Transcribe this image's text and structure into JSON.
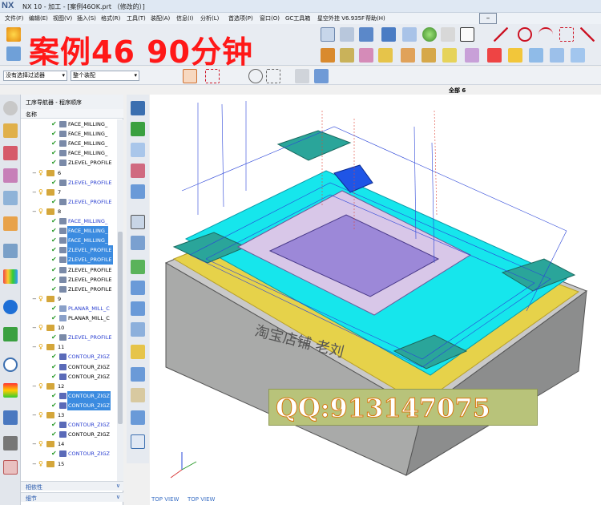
{
  "window": {
    "logo": "NX",
    "title": "NX 10 - 加工 - [案例46OK.prt （修改的）]"
  },
  "menu": [
    "文件(F)",
    "编辑(E)",
    "视图(V)",
    "插入(S)",
    "格式(R)",
    "工具(T)",
    "装配(A)",
    "信息(I)",
    "分析(L)",
    "首选项(P)",
    "窗口(O)",
    "GC工具箱",
    "星空外挂 V6.935F",
    "帮助(H)"
  ],
  "overlay": {
    "title": "案例46   90分钟",
    "qq": "QQ:913147075"
  },
  "selection": {
    "filter": "没有选择过滤器",
    "scope": "整个装配"
  },
  "viewport": {
    "layer_label": "全部 6",
    "view_labels": [
      "TOP VIEW",
      "TOP VIEW"
    ]
  },
  "navigator": {
    "title": "工序导航器 - 程序顺序",
    "column": "名称",
    "rows": [
      {
        "text": "FACE_MILLING_",
        "type": "op"
      },
      {
        "text": "FACE_MILLING_",
        "type": "op"
      },
      {
        "text": "FACE_MILLING_",
        "type": "op"
      },
      {
        "text": "FACE_MILLING_",
        "type": "op"
      },
      {
        "text": "ZLEVEL_PROFILE",
        "type": "op"
      },
      {
        "text": "6",
        "type": "group"
      },
      {
        "text": "ZLEVEL_PROFILE",
        "type": "op-blue"
      },
      {
        "text": "7",
        "type": "group"
      },
      {
        "text": "ZLEVEL_PROFILE",
        "type": "op-blue"
      },
      {
        "text": "8",
        "type": "group"
      },
      {
        "text": "FACE_MILLING_",
        "type": "op-blue"
      },
      {
        "text": "FACE_MILLING_",
        "type": "op-sel"
      },
      {
        "text": "FACE_MILLING_",
        "type": "op-sel"
      },
      {
        "text": "ZLEVEL_PROFILE",
        "type": "op-sel"
      },
      {
        "text": "ZLEVEL_PROFILE",
        "type": "op-sel"
      },
      {
        "text": "ZLEVEL_PROFILE",
        "type": "op"
      },
      {
        "text": "ZLEVEL_PROFILE",
        "type": "op"
      },
      {
        "text": "ZLEVEL_PROFILE",
        "type": "op"
      },
      {
        "text": "9",
        "type": "group"
      },
      {
        "text": "PLANAR_MILL_C",
        "type": "op-blue"
      },
      {
        "text": "PLANAR_MILL_C",
        "type": "op"
      },
      {
        "text": "10",
        "type": "group"
      },
      {
        "text": "ZLEVEL_PROFILE",
        "type": "op-blue"
      },
      {
        "text": "11",
        "type": "group"
      },
      {
        "text": "CONTOUR_ZIGZ",
        "type": "op-blue"
      },
      {
        "text": "CONTOUR_ZIGZ",
        "type": "op"
      },
      {
        "text": "CONTOUR_ZIGZ",
        "type": "op"
      },
      {
        "text": "12",
        "type": "group"
      },
      {
        "text": "CONTOUR_ZIGZ",
        "type": "op-sel"
      },
      {
        "text": "CONTOUR_ZIGZ",
        "type": "op-sel"
      },
      {
        "text": "13",
        "type": "group"
      },
      {
        "text": "CONTOUR_ZIGZ",
        "type": "op-blue"
      },
      {
        "text": "CONTOUR_ZIGZ",
        "type": "op"
      },
      {
        "text": "14",
        "type": "group"
      },
      {
        "text": "CONTOUR_ZIGZ",
        "type": "op-blue"
      },
      {
        "text": "15",
        "type": "group"
      }
    ],
    "footer": [
      "相依性",
      "细节"
    ]
  },
  "model": {
    "engraving": "淘宝店铺 老刘"
  },
  "colors": {
    "accent": "#3b8be0",
    "overlay_red": "#ff1818",
    "cyan": "#16e6ec",
    "teal": "#2aa59a",
    "yellow": "#e6d24a"
  }
}
